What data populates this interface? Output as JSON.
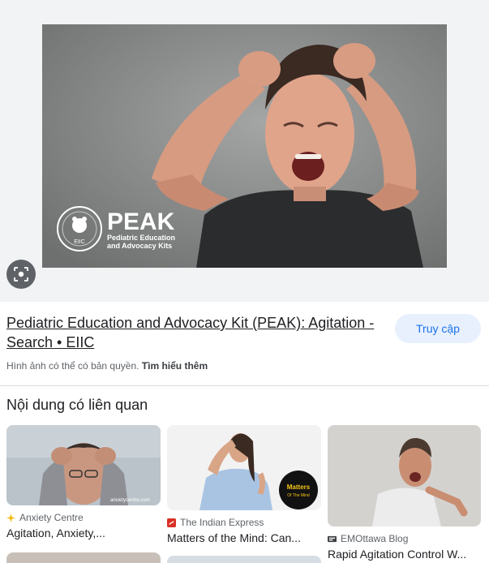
{
  "hero": {
    "logo_text": "PEAK",
    "logo_subtitle_1": "Pediatric Education",
    "logo_subtitle_2": "and Advocacy Kits",
    "seal_text": "EIIC"
  },
  "result": {
    "title": "Pediatric Education and Advocacy Kit (PEAK): Agitation - Search • EIIC",
    "visit_label": "Truy cập",
    "copyright_text": "Hình ảnh có thể có bản quyền.",
    "learn_more_label": "Tìm hiểu thêm"
  },
  "related": {
    "heading": "Nội dung có liên quan",
    "items": [
      {
        "source": "Anxiety Centre",
        "caption": "Agitation, Anxiety,...",
        "watermark": "anxietycentre.com",
        "icon_color": "#f4b400"
      },
      {
        "source": "The Indian Express",
        "caption": "Matters of the Mind: Can...",
        "badge_1": "Matters",
        "badge_2": "Of The Mind",
        "icon_color": "#d93025"
      },
      {
        "source": "EMOttawa Blog",
        "caption": "Rapid Agitation Control W...",
        "icon_color": "#3c4043"
      }
    ]
  },
  "icons": {
    "lens": "lens-icon"
  },
  "colors": {
    "accent": "#1a73e8",
    "visit_bg": "#e8f0fe"
  }
}
